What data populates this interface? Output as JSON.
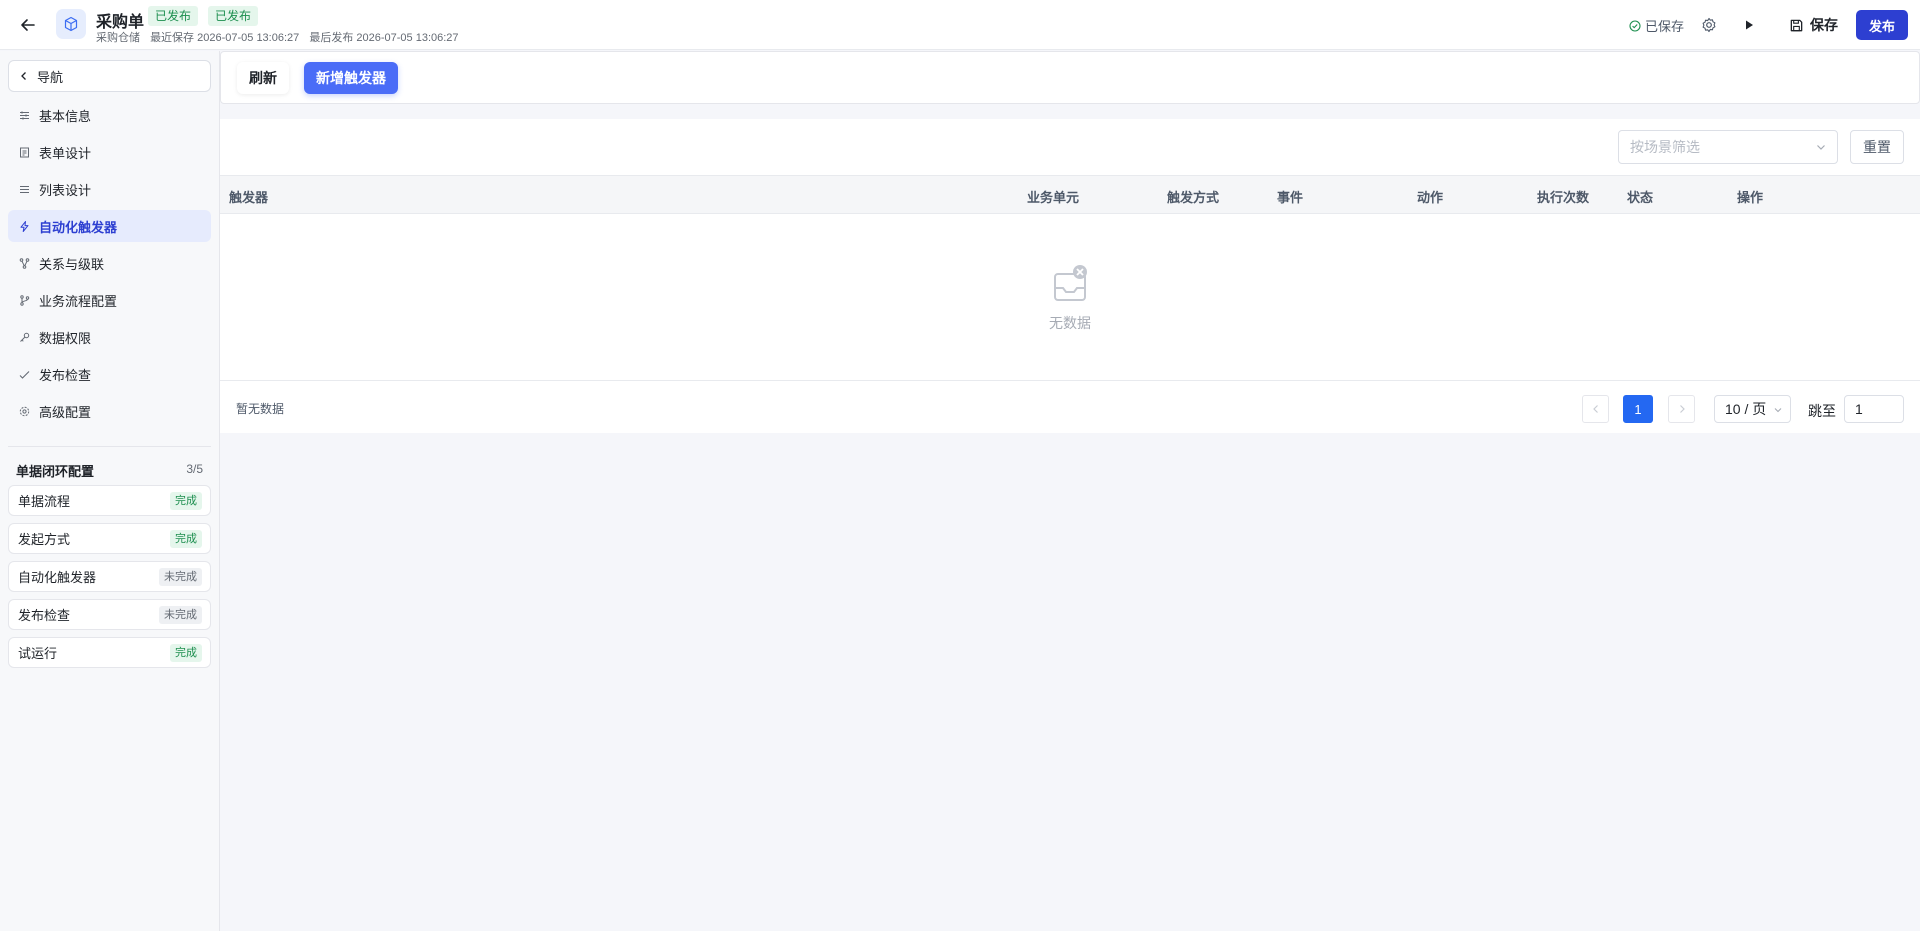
{
  "header": {
    "title": "采购单",
    "tags": [
      "已发布",
      "已发布"
    ],
    "app_name": "采购仓储",
    "last_saved": "最近保存 2026-07-05 13:06:27",
    "last_published": "最后发布 2026-07-05 13:06:27",
    "saved_status": "已保存",
    "save_label": "保存",
    "publish_label": "发布"
  },
  "sidebar": {
    "nav_label": "导航",
    "items": [
      {
        "label": "基本信息",
        "icon": "sliders-icon"
      },
      {
        "label": "表单设计",
        "icon": "form-icon"
      },
      {
        "label": "列表设计",
        "icon": "list-icon"
      },
      {
        "label": "自动化触发器",
        "icon": "lightning-icon",
        "active": true
      },
      {
        "label": "关系与级联",
        "icon": "relation-icon"
      },
      {
        "label": "业务流程配置",
        "icon": "branch-icon"
      },
      {
        "label": "数据权限",
        "icon": "key-icon"
      },
      {
        "label": "发布检查",
        "icon": "check-icon"
      },
      {
        "label": "高级配置",
        "icon": "gear-icon"
      }
    ],
    "loop": {
      "title": "单据闭环配置",
      "count": "3/5",
      "items": [
        {
          "label": "单据流程",
          "status": "完成"
        },
        {
          "label": "发起方式",
          "status": "完成"
        },
        {
          "label": "自动化触发器",
          "status": "未完成"
        },
        {
          "label": "发布检查",
          "status": "未完成"
        },
        {
          "label": "试运行",
          "status": "完成"
        }
      ]
    }
  },
  "toolbar": {
    "refresh_label": "刷新",
    "add_label": "新增触发器"
  },
  "filter": {
    "scene_placeholder": "按场景筛选",
    "reset_label": "重置"
  },
  "table": {
    "columns": [
      "触发器",
      "业务单元",
      "触发方式",
      "事件",
      "动作",
      "执行次数",
      "状态",
      "操作"
    ],
    "empty_text": "无数据"
  },
  "pagination": {
    "info": "暂无数据",
    "current_page": "1",
    "page_size": "10 / 页",
    "jump_label": "跳至",
    "jump_value": "1"
  },
  "colors": {
    "primary": "#2d3fd1",
    "accent": "#4a6cf7",
    "page_active": "#2468f2",
    "done_bg": "#e5f6ec",
    "done_text": "#1d8f4f"
  }
}
